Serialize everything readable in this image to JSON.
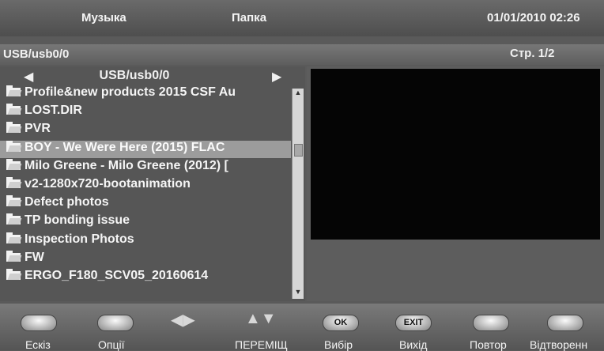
{
  "header": {
    "music_tab": "Музыка",
    "folder_tab": "Папка",
    "datetime": "01/01/2010 02:26"
  },
  "pathbar": {
    "path": "USB/usb0/0",
    "page": "Стр. 1/2"
  },
  "browser": {
    "current_dir": "USB/usb0/0",
    "left_arrow": "◀",
    "right_arrow": "▶",
    "items": [
      {
        "label": "Profile&new products 2015 CSF Au",
        "icon": "folder-icon"
      },
      {
        "label": "LOST.DIR",
        "icon": "folder-icon"
      },
      {
        "label": "PVR",
        "icon": "folder-icon"
      },
      {
        "label": "BOY - We Were Here (2015) FLAC",
        "icon": "folder-icon"
      },
      {
        "label": "Milo Greene - Milo Greene (2012) [",
        "icon": "folder-icon"
      },
      {
        "label": "v2-1280x720-bootanimation",
        "icon": "folder-icon"
      },
      {
        "label": "Defect photos",
        "icon": "folder-icon"
      },
      {
        "label": "TP bonding issue",
        "icon": "folder-icon"
      },
      {
        "label": "Inspection Photos",
        "icon": "folder-icon"
      },
      {
        "label": "FW",
        "icon": "folder-icon"
      },
      {
        "label": "ERGO_F180_SCV05_20160614",
        "icon": "folder-icon"
      }
    ],
    "selected_index": 3
  },
  "footer": {
    "ok_key": "OK",
    "exit_key": "EXIT",
    "labels": {
      "thumbnail": "Ескіз",
      "options": "Опції",
      "move": "ПЕРЕМІЩ",
      "select": "Вибір",
      "exit": "Вихід",
      "repeat": "Повтор",
      "play": "Відтворенн"
    }
  }
}
